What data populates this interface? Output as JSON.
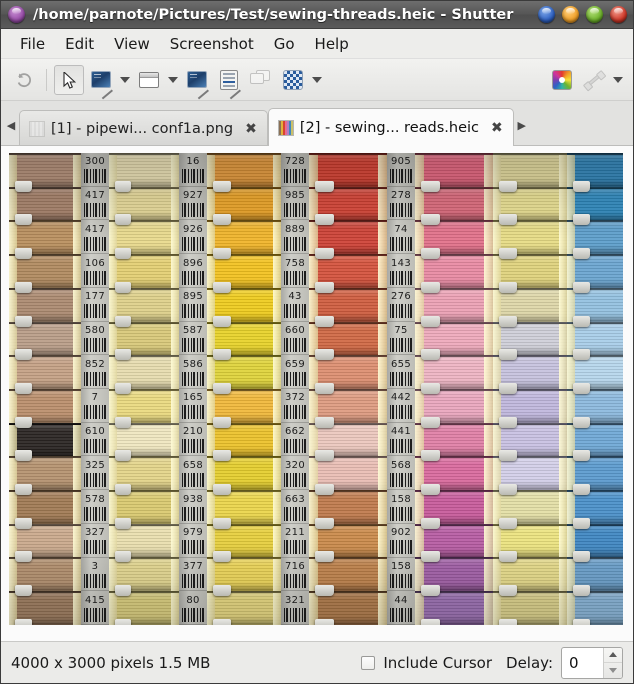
{
  "window": {
    "title": "/home/parnote/Pictures/Test/sewing-threads.heic - Shutter",
    "app_icon": "app-orb-icon",
    "buttons": [
      {
        "name": "shade-button",
        "icon": "orb-blue-icon",
        "color": "#2f62c4"
      },
      {
        "name": "minimize-button",
        "icon": "orb-orange-icon",
        "color": "#f0a028"
      },
      {
        "name": "maximize-button",
        "icon": "orb-green-icon",
        "color": "#6fb32c"
      },
      {
        "name": "close-button",
        "icon": "orb-red-icon",
        "color": "#d03828"
      }
    ]
  },
  "menubar": {
    "items": [
      {
        "label": "File"
      },
      {
        "label": "Edit"
      },
      {
        "label": "View"
      },
      {
        "label": "Screenshot"
      },
      {
        "label": "Go"
      },
      {
        "label": "Help"
      }
    ]
  },
  "toolbar": {
    "items": [
      {
        "name": "undo-button",
        "icon": "undo-arrow-icon",
        "enabled": false
      },
      {
        "name": "selection-tool-button",
        "icon": "mouse-cursor-icon",
        "pressed": true
      },
      {
        "name": "capture-selection-button",
        "icon": "monitor-pen-icon"
      },
      {
        "name": "capture-selection-menu",
        "icon": "chevron-down-icon"
      },
      {
        "name": "capture-window-button",
        "icon": "window-icon"
      },
      {
        "name": "capture-window-menu",
        "icon": "chevron-down-icon"
      },
      {
        "name": "capture-web-button",
        "icon": "monitor-web-icon"
      },
      {
        "name": "capture-menu-button",
        "icon": "menu-list-icon"
      },
      {
        "name": "capture-tooltip-button",
        "icon": "tooltip-balloon-icon",
        "enabled": false
      },
      {
        "name": "capture-redo-button",
        "icon": "checkerboard-icon"
      },
      {
        "name": "capture-redo-menu",
        "icon": "chevron-down-icon"
      },
      {
        "name": "edit-image-button",
        "icon": "color-wheel-icon"
      },
      {
        "name": "plugin-button",
        "icon": "plugin-pen-icon",
        "enabled": false
      },
      {
        "name": "plugin-menu",
        "icon": "chevron-down-icon"
      }
    ]
  },
  "tabs": {
    "scroll_left": "◀",
    "scroll_right": "▶",
    "close_glyph": "✖",
    "items": [
      {
        "label": "[1] - pipewi... conf1a.png",
        "icon": "tab-thumbnail-icon",
        "active": false
      },
      {
        "label": "[2] - sewing...  reads.heic",
        "icon": "tab-thumbnail-icon",
        "active": true
      }
    ]
  },
  "statusbar": {
    "dimensions": "4000 x 3000 pixels  1.5 MB",
    "include_cursor_label": "Include Cursor",
    "include_cursor_checked": false,
    "delay_label": "Delay:",
    "delay_value": "0",
    "spin_up": "spin-up-icon",
    "spin_down": "spin-down-icon"
  },
  "photo": {
    "description": "Rack of sewing thread spools arranged in vertical colour-graded columns with numbered barcode label strips between them",
    "columns": [
      {
        "name": "brown-tan-column",
        "width": 72,
        "colors": [
          "#b69078",
          "#a8826a",
          "#b98f5e",
          "#b08a5f",
          "#ab8a70",
          "#b99d88",
          "#c4a084",
          "#ba8e6c",
          "#a8apine",
          "#b5926f",
          "#a07a54",
          "#caa98c",
          "#b4906e",
          "#9d7b5c"
        ]
      },
      {
        "name": "cream-yellow-column-1",
        "width": 70,
        "colors": [
          "#efe4b6",
          "#eadc9a",
          "#e8d98c",
          "#e3cf72",
          "#ded08a",
          "#d8c878",
          "#e6dcae",
          "#ead97f",
          "#efe6c0",
          "#e3d489",
          "#d9c96f",
          "#e9dfae",
          "#e5d890",
          "#dccf7c"
        ]
      },
      {
        "name": "orange-yellow-column",
        "width": 74,
        "colors": [
          "#e89b3a",
          "#eea526",
          "#f0b429",
          "#f2c21f",
          "#eecb1d",
          "#e7d229",
          "#dfd33a",
          "#f0b83a",
          "#ecc22a",
          "#e4cd2d",
          "#ebd54a",
          "#e6cf3c",
          "#efd757",
          "#e9d97e"
        ]
      },
      {
        "name": "red-coral-column",
        "width": 78,
        "colors": [
          "#d93f30",
          "#d84436",
          "#cd4236",
          "#d4523c",
          "#cf5c3e",
          "#d06844",
          "#dd8e70",
          "#de9b80",
          "#ecc7bd",
          "#e9bdb4",
          "#c07a4c",
          "#ca8a4a",
          "#c2834b",
          "#b07a48"
        ]
      },
      {
        "name": "pink-rose-column",
        "width": 78,
        "colors": [
          "#e8647f",
          "#df6b7d",
          "#e2718a",
          "#e88aa3",
          "#ecA0b4",
          "#eea9bb",
          "#eeb4c3",
          "#e9a6bd",
          "#e07fa6",
          "#d9699d",
          "#c75a9b",
          "#b75ba3",
          "#a35fa8",
          "#9c6fb4"
        ]
      },
      {
        "name": "yellow-lilac-column",
        "width": 74,
        "colors": [
          "#e7de9e",
          "#ece292",
          "#e6db84",
          "#dfd27c",
          "#ded6a8",
          "#cfcfd8",
          "#c6c2de",
          "#bfb7dd",
          "#c8c1e2",
          "#d3cfe8",
          "#e3dfa6",
          "#ece37f",
          "#e8dd8a",
          "#ded38a"
        ]
      },
      {
        "name": "blue-column",
        "width": 72,
        "colors": [
          "#2f87bc",
          "#2f8cc2",
          "#5c9ecb",
          "#6aa5d0",
          "#93c1e0",
          "#a8cde8",
          "#b6d6ec",
          "#8cb9de",
          "#6fa8d6",
          "#5b9bcf",
          "#4a90c9",
          "#3e86c2",
          "#6aa0cc",
          "#86b4d8"
        ]
      }
    ],
    "label_strips": [
      {
        "name": "label-strip-1",
        "numbers": [
          "300",
          "417",
          "417",
          "106",
          "177",
          "580",
          "852",
          "7",
          "610",
          "325",
          "578",
          "327",
          "3",
          "415"
        ]
      },
      {
        "name": "label-strip-2",
        "numbers": [
          "16",
          "927",
          "926",
          "896",
          "895",
          "587",
          "586",
          "165",
          "210",
          "658",
          "938",
          "979",
          "377",
          "80"
        ]
      },
      {
        "name": "label-strip-3",
        "numbers": [
          "728",
          "985",
          "889",
          "758",
          "43",
          "660",
          "659",
          "372",
          "662",
          "320",
          "663",
          "211",
          "716",
          "321"
        ]
      },
      {
        "name": "label-strip-4",
        "numbers": [
          "905",
          "278",
          "74",
          "143",
          "276",
          "75",
          "655",
          "442",
          "441",
          "568",
          "158",
          "902",
          "158",
          "44"
        ]
      }
    ]
  }
}
